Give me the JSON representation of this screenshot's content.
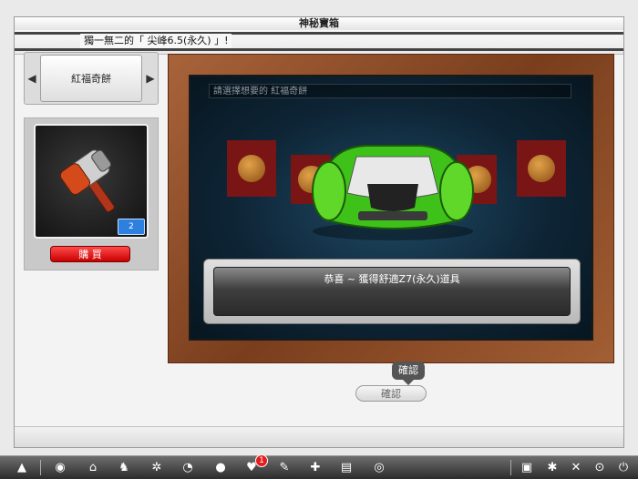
{
  "window": {
    "title": "神秘寶箱",
    "notice": "獨一無二的「 尖峰6.5(永久) 」!"
  },
  "selector": {
    "label": "紅福奇餅",
    "prev_icon": "triangle-left-icon",
    "next_icon": "triangle-right-icon"
  },
  "item": {
    "icon": "hammer-icon",
    "count": "2",
    "buy_label": "購 買"
  },
  "stage": {
    "prompt": "請選擇想要的 紅福奇餅",
    "result": "恭喜 ~ 獲得舒適Z7(永久)道具"
  },
  "confirm": {
    "tooltip": "確認",
    "button": "確認"
  },
  "taskbar": {
    "left_icons": [
      "start-icon",
      "back-icon",
      "shop-icon",
      "character-icon",
      "settings-icon",
      "search-icon",
      "egg-icon",
      "heart-icon",
      "pencil-icon",
      "shirt-icon",
      "book-icon",
      "radio-icon"
    ],
    "heart_badge": "1",
    "right_icons": [
      "folder-icon",
      "network-icon",
      "tools-icon",
      "magnifier-icon",
      "power-icon"
    ]
  }
}
